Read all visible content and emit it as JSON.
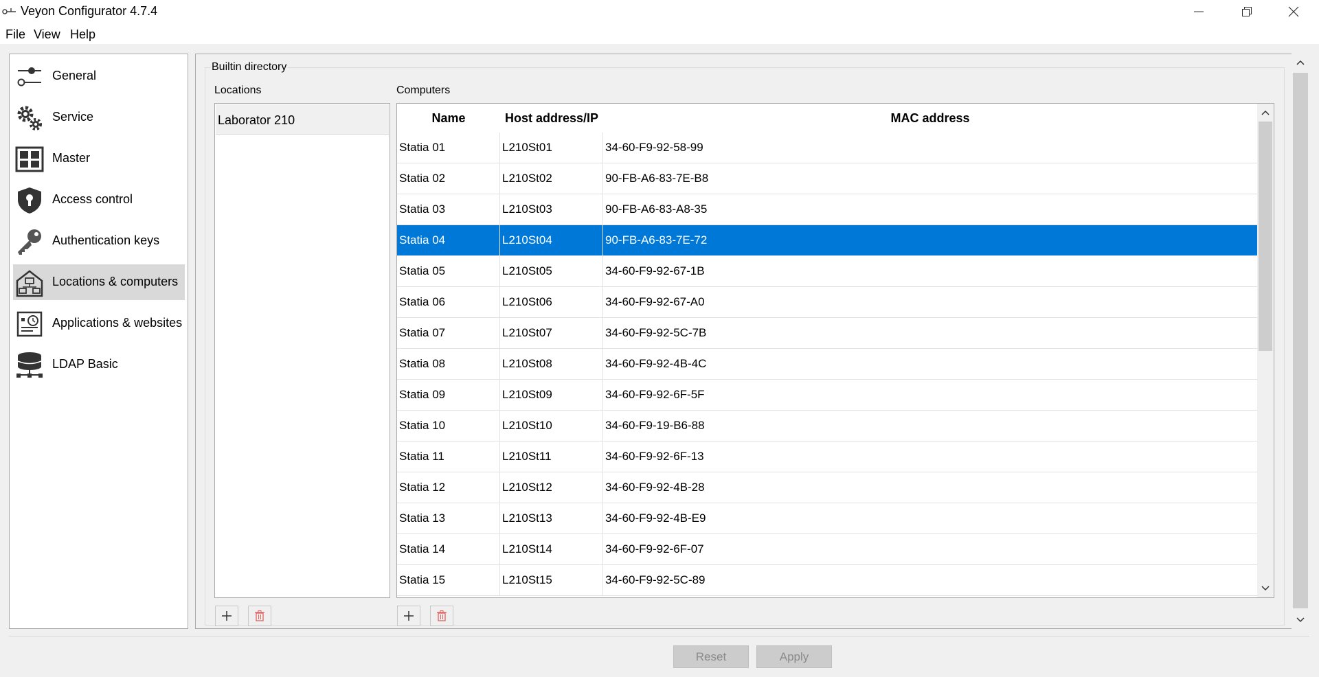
{
  "window": {
    "title": "Veyon Configurator 4.7.4"
  },
  "menu": [
    "File",
    "View",
    "Help"
  ],
  "sidebar": {
    "items": [
      {
        "label": "General",
        "icon": "sliders-icon",
        "active": false
      },
      {
        "label": "Service",
        "icon": "gears-icon",
        "active": false
      },
      {
        "label": "Master",
        "icon": "dashboard-grid-icon",
        "active": false
      },
      {
        "label": "Access control",
        "icon": "shield-keyhole-icon",
        "active": false
      },
      {
        "label": "Authentication keys",
        "icon": "key-icon",
        "active": false
      },
      {
        "label": "Locations & computers",
        "icon": "network-computers-icon",
        "active": true
      },
      {
        "label": "Applications & websites",
        "icon": "app-clock-icon",
        "active": false
      },
      {
        "label": "LDAP Basic",
        "icon": "database-network-icon",
        "active": false
      }
    ]
  },
  "builtin": {
    "group_title": "Builtin directory",
    "locations_label": "Locations",
    "computers_label": "Computers",
    "locations": [
      "Laborator 210"
    ],
    "columns": [
      "Name",
      "Host address/IP",
      "MAC address"
    ],
    "selected_row": 3,
    "computers": [
      [
        "Statia 01",
        "L210St01",
        "34-60-F9-92-58-99"
      ],
      [
        "Statia 02",
        "L210St02",
        "90-FB-A6-83-7E-B8"
      ],
      [
        "Statia 03",
        "L210St03",
        "90-FB-A6-83-A8-35"
      ],
      [
        "Statia 04",
        "L210St04",
        "90-FB-A6-83-7E-72"
      ],
      [
        "Statia 05",
        "L210St05",
        "34-60-F9-92-67-1B"
      ],
      [
        "Statia 06",
        "L210St06",
        "34-60-F9-92-67-A0"
      ],
      [
        "Statia 07",
        "L210St07",
        "34-60-F9-92-5C-7B"
      ],
      [
        "Statia 08",
        "L210St08",
        "34-60-F9-92-4B-4C"
      ],
      [
        "Statia 09",
        "L210St09",
        "34-60-F9-92-6F-5F"
      ],
      [
        "Statia 10",
        "L210St10",
        "34-60-F9-19-B6-88"
      ],
      [
        "Statia 11",
        "L210St11",
        "34-60-F9-92-6F-13"
      ],
      [
        "Statia 12",
        "L210St12",
        "34-60-F9-92-4B-28"
      ],
      [
        "Statia 13",
        "L210St13",
        "34-60-F9-92-4B-E9"
      ],
      [
        "Statia 14",
        "L210St14",
        "34-60-F9-92-6F-07"
      ],
      [
        "Statia 15",
        "L210St15",
        "34-60-F9-92-5C-89"
      ]
    ]
  },
  "buttons": {
    "reset": "Reset",
    "apply": "Apply"
  },
  "colors": {
    "selection": "#0078d7",
    "delete_icon": "#e0605e"
  }
}
